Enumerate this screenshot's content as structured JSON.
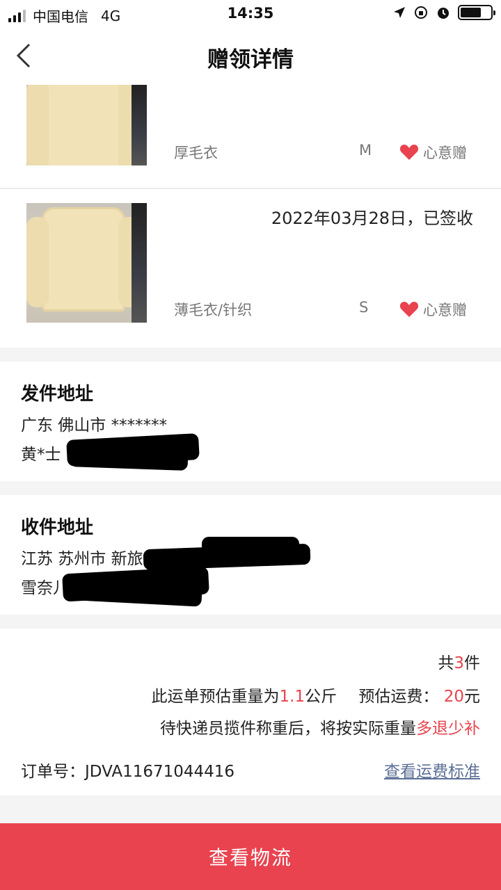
{
  "status_bar": {
    "carrier": "中国电信",
    "network": "4G",
    "time": "14:35",
    "battery_level": 0.7
  },
  "nav": {
    "title": "赠领详情",
    "back_icon": "chevron-left-icon"
  },
  "items": [
    {
      "name": "厚毛衣",
      "size": "M",
      "tag": "心意赠",
      "status": ""
    },
    {
      "name": "薄毛衣/针织",
      "size": "S",
      "tag": "心意赠",
      "status": "2022年03月28日，已签收"
    }
  ],
  "sender": {
    "title": "发件地址",
    "region": "广东 佛山市 *******",
    "contact": "黄*士 1"
  },
  "receiver": {
    "title": "收件地址",
    "region": "江苏 苏州市 新旅",
    "contact": "雪奈儿"
  },
  "order": {
    "count_prefix": "共",
    "count": "3",
    "count_suffix": "件",
    "weight_prefix": "此运单预估重量为",
    "weight": "1.1",
    "weight_unit": "公斤",
    "fee_prefix": "预估运费：",
    "fee": "20",
    "fee_unit": "元",
    "note_prefix": "待快递员揽件称重后，将按实际重量",
    "note_highlight": "多退少补",
    "number_label": "订单号：",
    "number": "JDVA11671044416",
    "fee_standard_link": "查看运费标准"
  },
  "colors": {
    "accent": "#e9434f",
    "link": "#5b6f96"
  },
  "bottom_button": {
    "label": "查看物流"
  }
}
